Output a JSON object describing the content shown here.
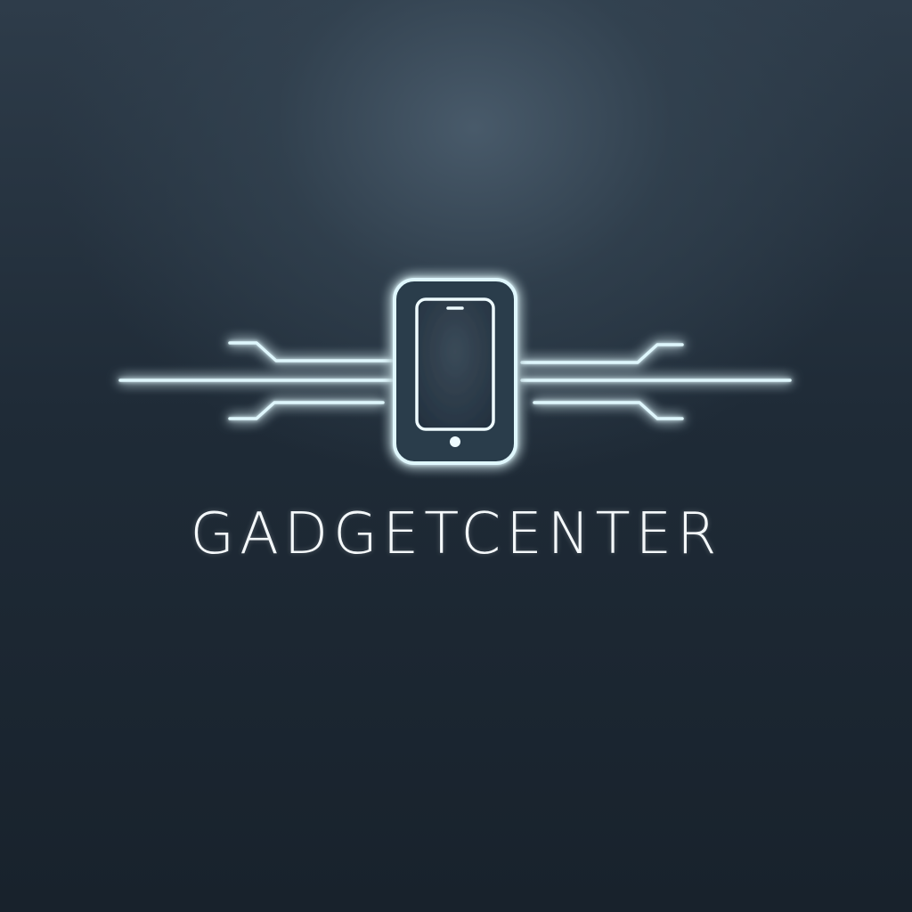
{
  "brand": {
    "wordmark": "GADGETCENTER"
  },
  "logo": {
    "icon": "smartphone-circuit-icon",
    "glow_color": "#5fd8f0",
    "line_color": "#dff7fd",
    "phone_screen_color": "#2a3846"
  },
  "colors": {
    "background_top": "#4a5c6c",
    "background_bottom": "#18222c",
    "text": "#f4f8fa"
  }
}
